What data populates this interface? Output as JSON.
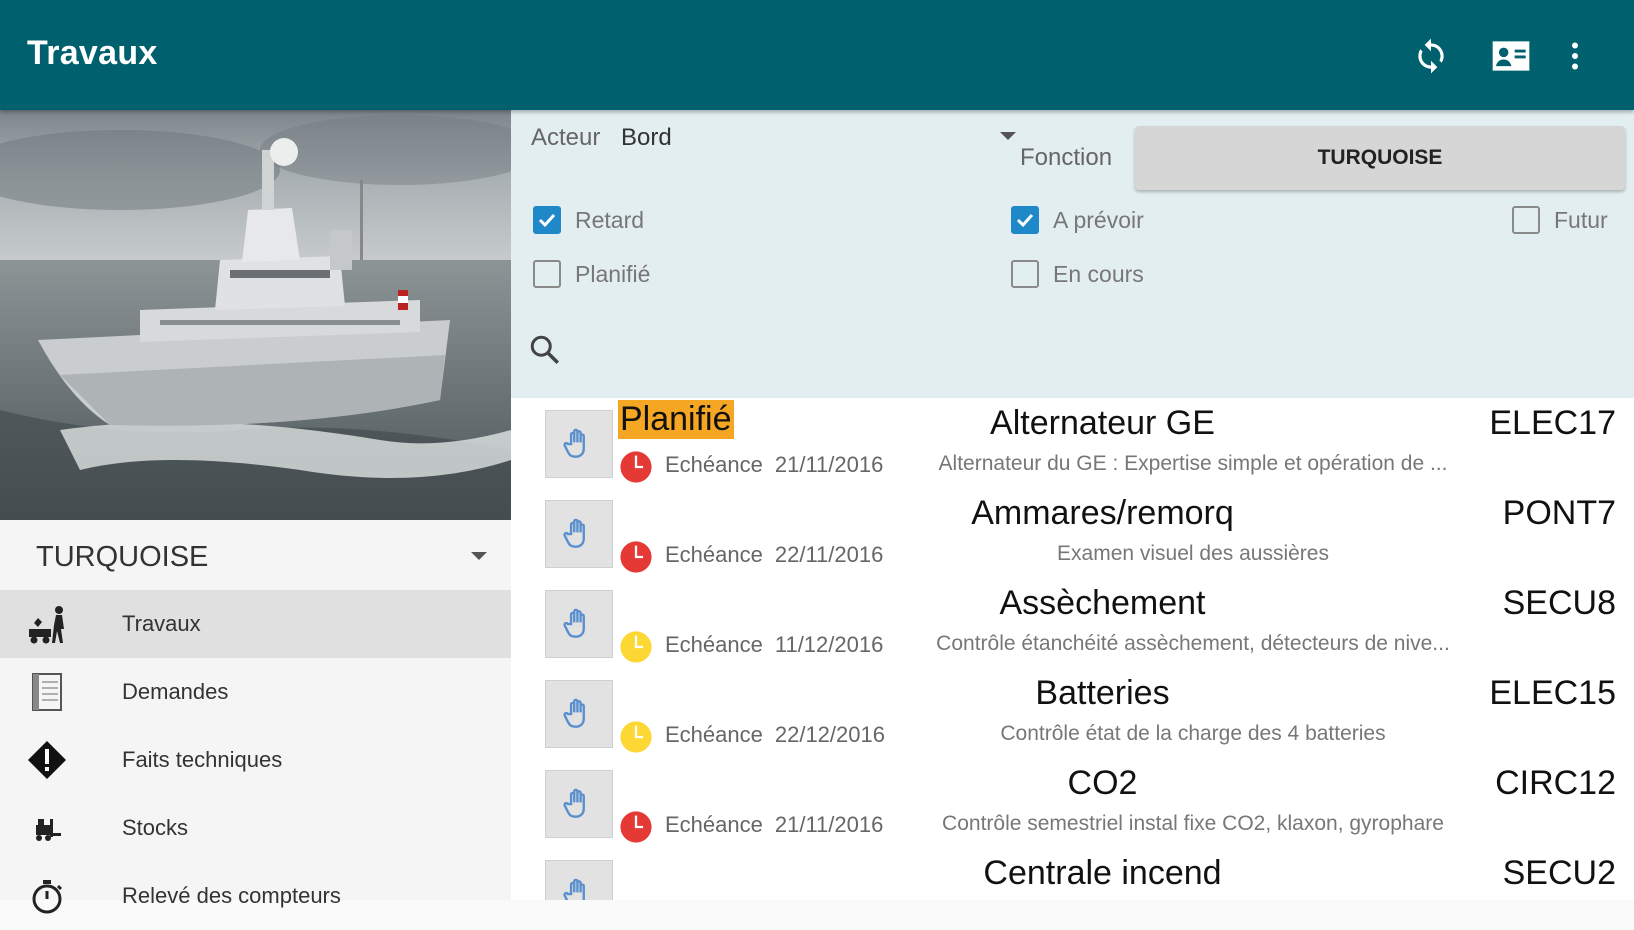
{
  "appbar": {
    "title": "Travaux",
    "actions": [
      "sync-icon",
      "contact-card-icon",
      "more-vert-icon"
    ]
  },
  "drawer": {
    "ship": "TURQUOISE",
    "items": [
      {
        "label": "Travaux",
        "icon": "worker-icon",
        "active": true
      },
      {
        "label": "Demandes",
        "icon": "notebook-icon",
        "active": false
      },
      {
        "label": "Faits techniques",
        "icon": "warning-diamond-icon",
        "active": false
      },
      {
        "label": "Stocks",
        "icon": "forklift-icon",
        "active": false
      },
      {
        "label": "Relevé des compteurs",
        "icon": "stopwatch-icon",
        "active": false
      }
    ]
  },
  "filters": {
    "acteur_label": "Acteur",
    "acteur_value": "Bord",
    "fonction_label": "Fonction",
    "fonction_value": "TURQUOISE",
    "checkboxes": [
      {
        "label": "Retard",
        "checked": true
      },
      {
        "label": "A prévoir",
        "checked": true
      },
      {
        "label": "Futur",
        "checked": false
      },
      {
        "label": "Planifié",
        "checked": false
      },
      {
        "label": "En cours",
        "checked": false
      }
    ]
  },
  "colors": {
    "appbar": "#00606e",
    "filter_bg": "#e3eef0",
    "checkbox_on": "#1e88c8",
    "status_highlight": "#f5a623",
    "clock_late": "#e53935",
    "clock_soon": "#fdd835",
    "row_divider": "#a9d0d5"
  },
  "tasks": [
    {
      "status": "Planifié",
      "name": "Alternateur GE",
      "code": "ELEC17",
      "due_label": "Echéance",
      "due_date": "21/11/2016",
      "description": "Alternateur du GE : Expertise simple et opération de ...",
      "clock": "red"
    },
    {
      "status": "",
      "name": "Ammares/remorq",
      "code": "PONT7",
      "due_label": "Echéance",
      "due_date": "22/11/2016",
      "description": "Examen visuel des aussières",
      "clock": "red"
    },
    {
      "status": "",
      "name": "Assèchement",
      "code": "SECU8",
      "due_label": "Echéance",
      "due_date": "11/12/2016",
      "description": "Contrôle étanchéité assèchement, détecteurs de nive...",
      "clock": "yellow"
    },
    {
      "status": "",
      "name": "Batteries",
      "code": "ELEC15",
      "due_label": "Echéance",
      "due_date": "22/12/2016",
      "description": "Contrôle état de la charge des 4 batteries",
      "clock": "yellow"
    },
    {
      "status": "",
      "name": "CO2",
      "code": "CIRC12",
      "due_label": "Echéance",
      "due_date": "21/11/2016",
      "description": "Contrôle semestriel instal fixe CO2, klaxon, gyrophare",
      "clock": "red"
    },
    {
      "status": "",
      "name": "Centrale incend",
      "code": "SECU2",
      "due_label": "",
      "due_date": "",
      "description": "",
      "clock": "none"
    }
  ]
}
